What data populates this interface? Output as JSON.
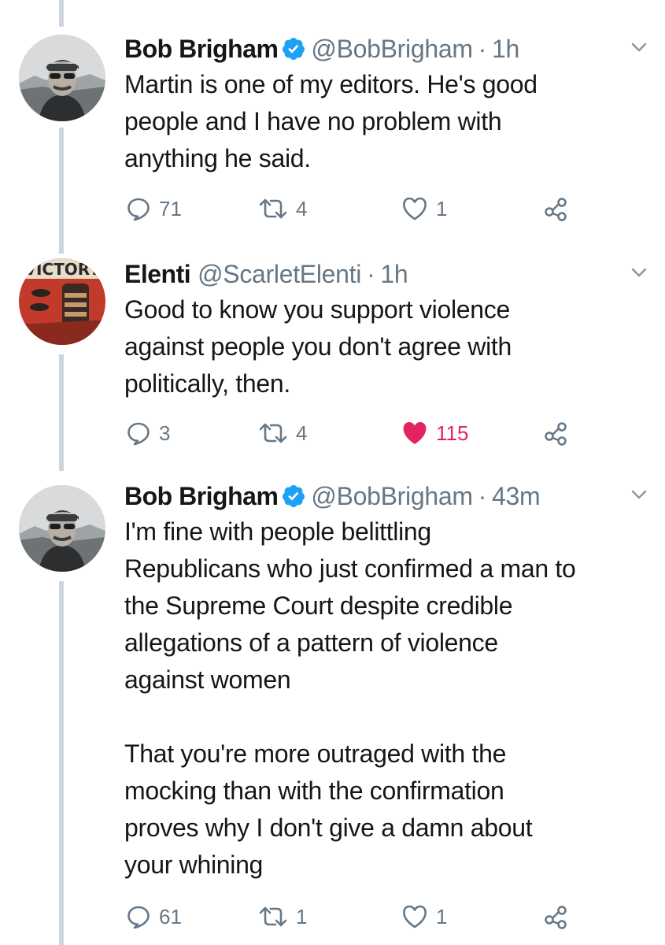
{
  "colors": {
    "text": "#14171a",
    "secondary": "#657786",
    "verified": "#1da1f2",
    "liked": "#e0245e",
    "thread_line": "#cdd6dd"
  },
  "tweets": [
    {
      "name": "Bob Brigham",
      "verified": true,
      "handle": "@BobBrigham",
      "separator": "·",
      "time": "1h",
      "text": "Martin is one of my editors. He's good\npeople and I have no problem with\nanything he said.",
      "replies": "71",
      "retweets": "4",
      "likes": "1",
      "liked": false,
      "icons": [
        "reply-icon",
        "retweet-icon",
        "like-icon",
        "share-icon",
        "chevron-down-icon"
      ]
    },
    {
      "name": "Elenti",
      "verified": false,
      "handle": "@ScarletElenti",
      "separator": "·",
      "time": "1h",
      "avatar_text": "VICTORY",
      "text": "Good to know you support violence\nagainst people you don't agree with\npolitically, then.",
      "replies": "3",
      "retweets": "4",
      "likes": "115",
      "liked": true,
      "icons": [
        "reply-icon",
        "retweet-icon",
        "heart-filled-icon",
        "share-icon",
        "chevron-down-icon"
      ]
    },
    {
      "name": "Bob Brigham",
      "verified": true,
      "handle": "@BobBrigham",
      "separator": "·",
      "time": "43m",
      "text": "I'm fine with people belittling\nRepublicans who just confirmed a man to\nthe Supreme Court despite credible\nallegations of a pattern of violence\nagainst women\n\nThat you're more outraged with the\nmocking than with the confirmation\nproves why I don't give a damn about\nyour whining",
      "replies": "61",
      "retweets": "1",
      "likes": "1",
      "liked": false,
      "icons": [
        "reply-icon",
        "retweet-icon",
        "like-icon",
        "share-icon",
        "chevron-down-icon"
      ]
    }
  ]
}
